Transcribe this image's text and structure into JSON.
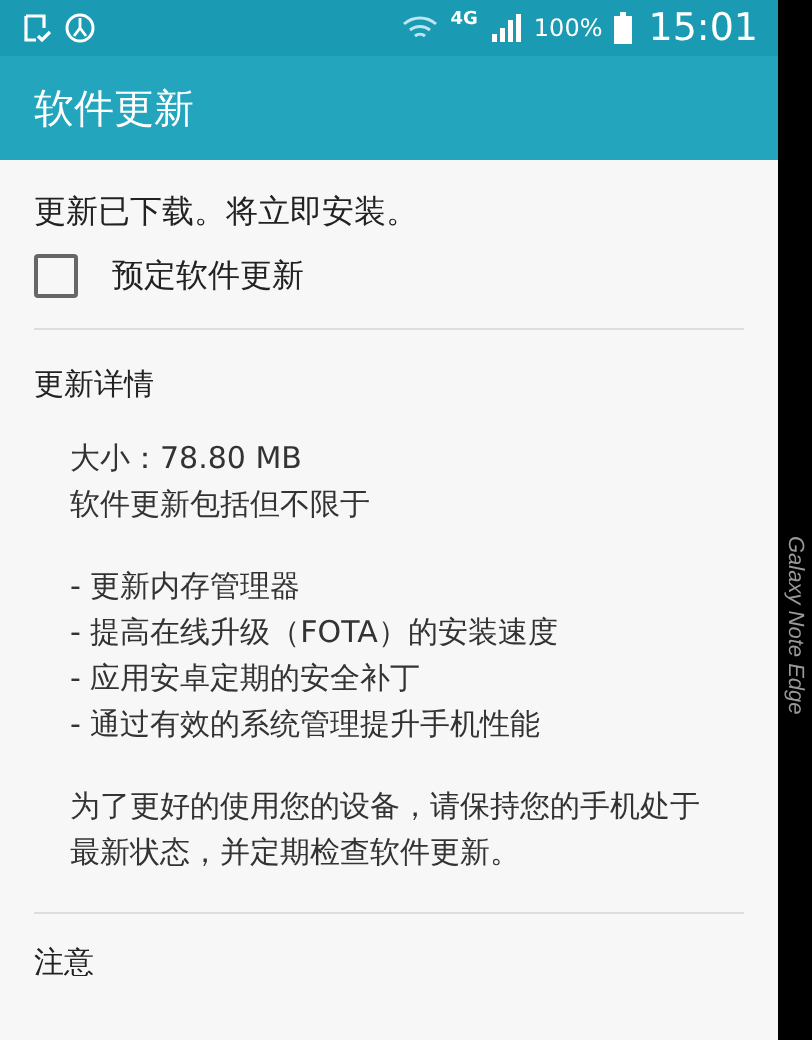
{
  "status_bar": {
    "network": "4G",
    "battery": "100%",
    "time": "15:01"
  },
  "app_bar": {
    "title": "软件更新"
  },
  "message": "更新已下载。将立即安装。",
  "schedule_option": {
    "label": "预定软件更新",
    "checked": false
  },
  "details": {
    "heading": "更新详情",
    "lines": [
      "大小：78.80 MB",
      "软件更新包括但不限于"
    ],
    "bullets": [
      "- 更新内存管理器",
      "- 提高在线升级（FOTA）的安装速度",
      "- 应用安卓定期的安全补丁",
      "- 通过有效的系统管理提升手机性能"
    ],
    "note": "为了更好的使用您的设备，请保持您的手机处于最新状态，并定期检查软件更新。"
  },
  "notice": {
    "heading": "注意"
  },
  "edge_label": "Galaxy Note Edge"
}
